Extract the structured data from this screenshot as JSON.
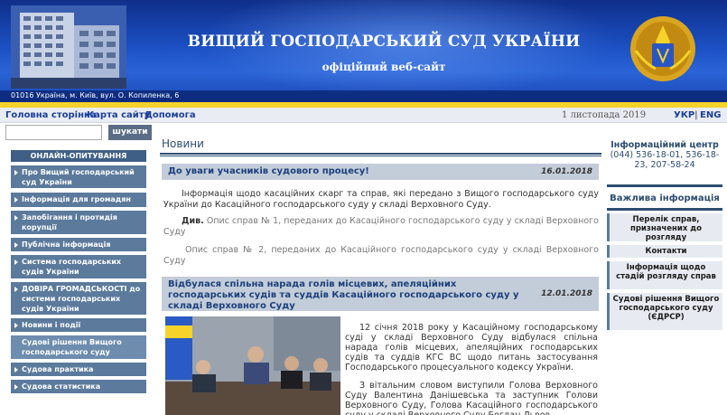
{
  "header": {
    "title": "ВИЩИЙ ГОСПОДАРСЬКИЙ СУД УКРАЇНИ",
    "subtitle": "офіційний веб-сайт",
    "address": "01016  Україна,  м. Київ,  вул. О. Копиленка, 6"
  },
  "topnav": {
    "home": "Головна сторінка",
    "sitemap": "Карта сайту",
    "help": "Допомога",
    "date": "1 листопада 2019",
    "lang_ukr": "УКР",
    "lang_sep": "|",
    "lang_eng": "ENG"
  },
  "search": {
    "value": "",
    "button": "шукати"
  },
  "sidebar": {
    "poll": "ОНЛАЙН-ОПИТУВАННЯ",
    "items": [
      {
        "label": "Про Вищий господарський суд України"
      },
      {
        "label": "Інформація для громадян"
      },
      {
        "label": "Запобігання і протидія корупції"
      },
      {
        "label": "Публічна інформація"
      },
      {
        "label": "Система господарських судів України"
      },
      {
        "label": "ДОВІРА ГРОМАДСЬКОСТІ до системи господарських судів України"
      },
      {
        "label": "Новини і події"
      },
      {
        "label": "Судові рішення Вищого господарського суду"
      },
      {
        "label": "Судова практика"
      },
      {
        "label": "Судова статистика"
      }
    ]
  },
  "main": {
    "section_title": "Новини",
    "news1": {
      "title": "До уваги учасників судового процесу!",
      "date": "16.01.2018",
      "text": "Інформація щодо касаційних скарг та справ, які передано з Вищого господарського суду України до Касаційного господарського суду у складі Верховного Суду.",
      "see_label": "Див.",
      "link1": "Опис справ № 1, переданих до Касаційного господарського суду у складі Верховного Суду",
      "link2": "Опис справ № 2, переданих до Касаційного господарського суду у складі Верховного Суду"
    },
    "news2": {
      "title": "Відбулася спільна нарада голів місцевих, апеляційних господарських судів та суддів Касаційного господарського суду у складі Верховного Суду",
      "date": "12.01.2018",
      "text1": "12 січня 2018 року у Касаційному господарському суді у складі Верховного Суду відбулася спільна нарада голів місцевих, апеляційних господарських судів та суддів КГС ВС щодо питань застосування Господарського процесуального кодексу України.",
      "text2": "З вітальним словом виступили Голова Верховного Суду Валентина Данішевська та заступник Голови Верховного Суду, Голова Касаційного господарського суду у складі Верховного Суду Богдан Львов."
    }
  },
  "right": {
    "info_title": "Інформаційний центр",
    "info_phones": "(044) 536-18-01, 536-18-23, 207-58-24",
    "important": "Важлива інформація",
    "boxes": [
      {
        "label": "Перелік справ, призначених до розгляду"
      },
      {
        "label": "Контакти"
      },
      {
        "label": "Інформація щодо стадій розгляду справ"
      },
      {
        "label": "Судові рішення Вищого господарського суду (ЄДРСР)"
      }
    ]
  },
  "colors": {
    "banner": "#1b4fc2",
    "accent_yellow": "#f5d32a",
    "menu": "#5b7a9c",
    "link": "#1b3f9a",
    "news_header": "#c3cdd9"
  }
}
